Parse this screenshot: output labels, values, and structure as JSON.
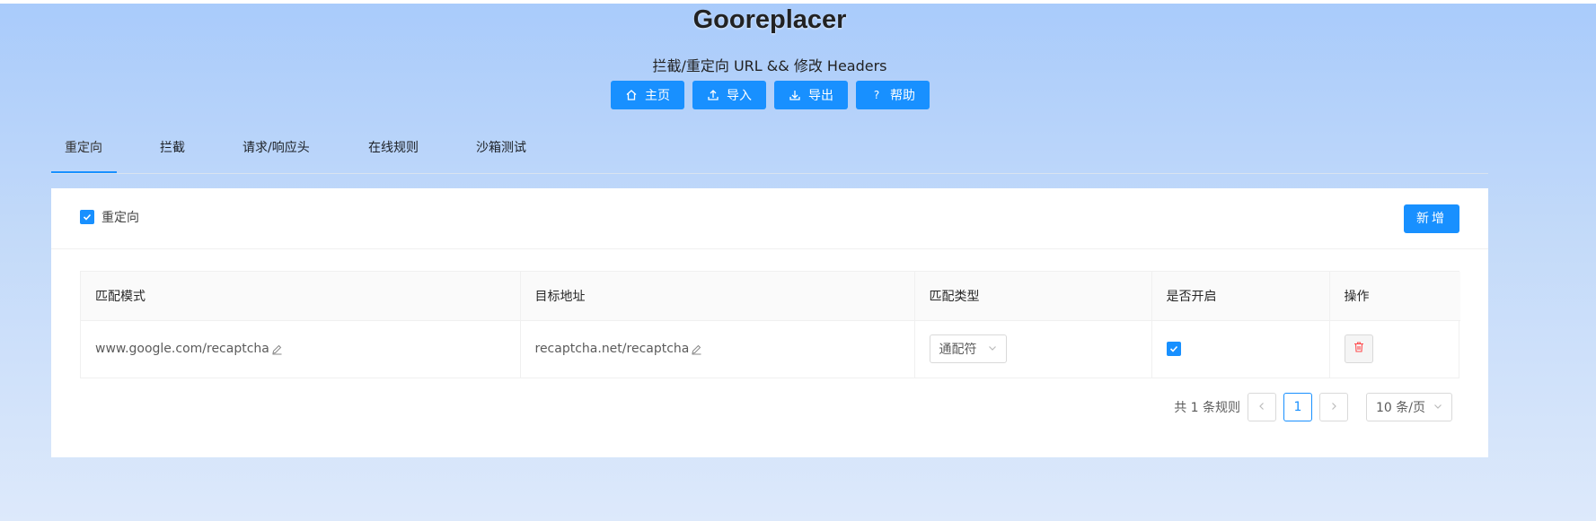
{
  "app": {
    "title": "Gooreplacer",
    "subtitle": "拦截/重定向 URL && 修改 Headers"
  },
  "toolbar": {
    "home_label": "主页",
    "import_label": "导入",
    "export_label": "导出",
    "help_label": "帮助"
  },
  "tabs": [
    {
      "label": "重定向",
      "active": true
    },
    {
      "label": "拦截",
      "active": false
    },
    {
      "label": "请求/响应头",
      "active": false
    },
    {
      "label": "在线规则",
      "active": false
    },
    {
      "label": "沙箱测试",
      "active": false
    }
  ],
  "panel": {
    "enable_label": "重定向",
    "enabled": true,
    "add_label": "新增"
  },
  "table": {
    "columns": [
      "匹配模式",
      "目标地址",
      "匹配类型",
      "是否开启",
      "操作"
    ],
    "rows": [
      {
        "pattern": "www.google.com/recaptcha",
        "target": "recaptcha.net/recaptcha",
        "match_type": "通配符",
        "enabled": true
      }
    ]
  },
  "pagination": {
    "total_text": "共 1 条规则",
    "current_page": "1",
    "page_size": "10 条/页"
  },
  "colors": {
    "accent": "#1890ff",
    "danger": "#ff4d4f"
  }
}
